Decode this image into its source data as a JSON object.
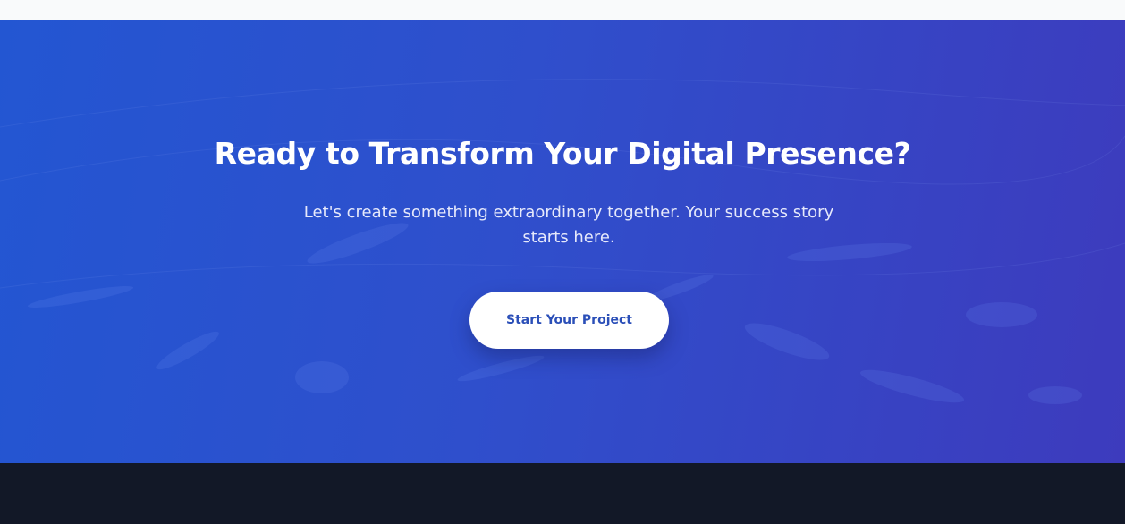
{
  "cta": {
    "title": "Ready to Transform Your Digital Presence?",
    "subtitle": "Let's create something extraordinary together. Your success story starts here.",
    "button_label": "Start Your Project"
  },
  "colors": {
    "gradient_start": "#2356d2",
    "gradient_end": "#3d3bbd",
    "button_text": "#2b4fb8",
    "footer_background": "#121827",
    "page_background": "#f9fafb"
  }
}
